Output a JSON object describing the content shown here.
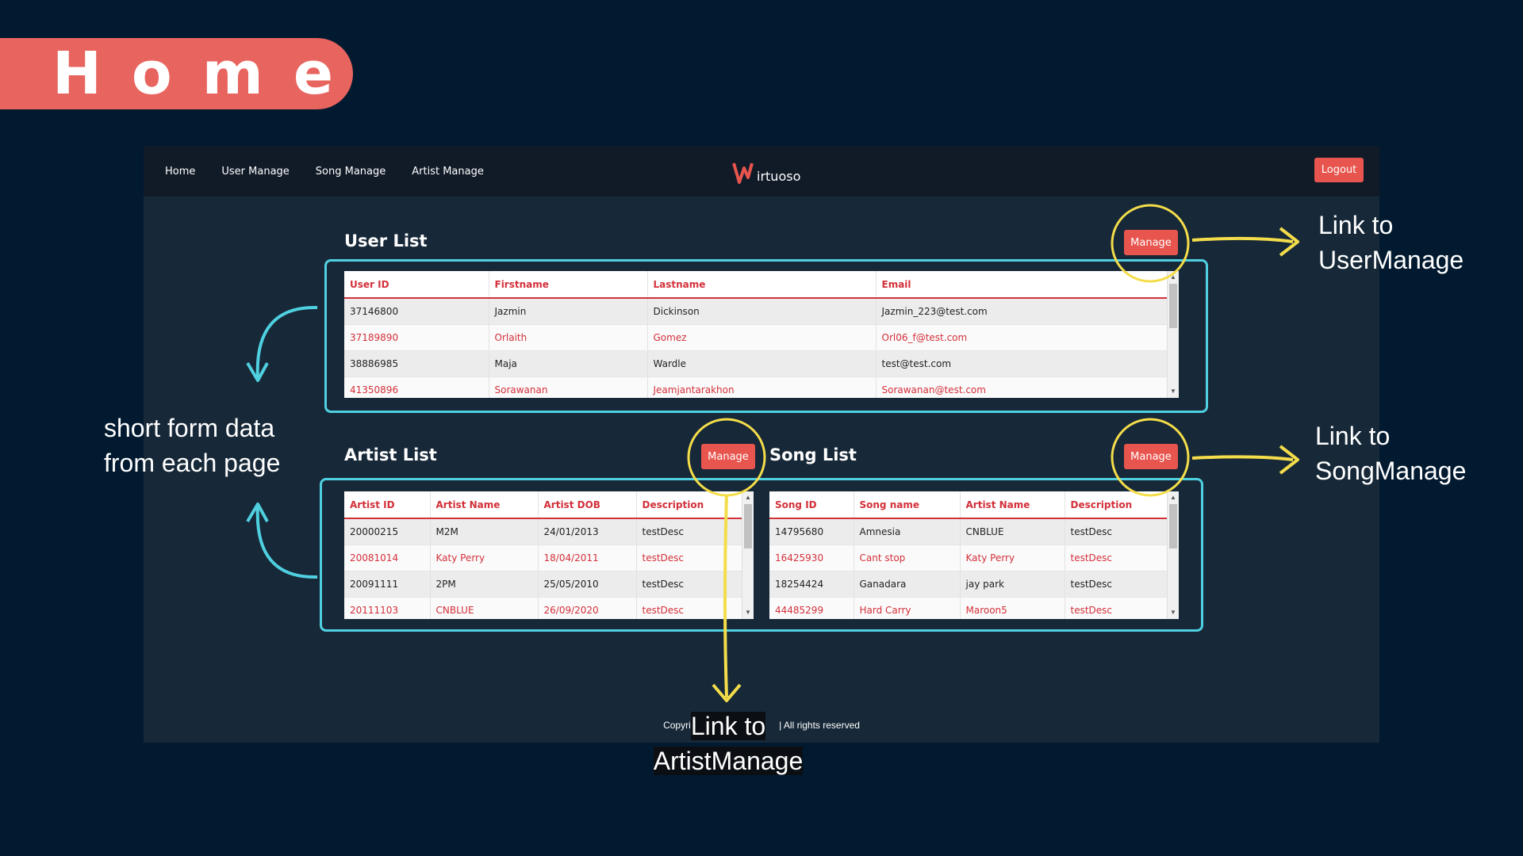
{
  "slide": {
    "title": "Home"
  },
  "navbar": {
    "links": [
      "Home",
      "User Manage",
      "Song Manage",
      "Artist Manage"
    ],
    "logo_text": "irtuoso",
    "logout_label": "Logout"
  },
  "user_list": {
    "title": "User List",
    "manage_label": "Manage",
    "headers": [
      "User ID",
      "Firstname",
      "Lastname",
      "Email"
    ],
    "rows": [
      [
        "37146800",
        "Jazmin",
        "Dickinson",
        "Jazmin_223@test.com"
      ],
      [
        "37189890",
        "Orlaith",
        "Gomez",
        "Orl06_f@test.com"
      ],
      [
        "38886985",
        "Maja",
        "Wardle",
        "test@test.com"
      ],
      [
        "41350896",
        "Sorawanan",
        "Jeamjantarakhon",
        "Sorawanan@test.com"
      ]
    ]
  },
  "artist_list": {
    "title": "Artist List",
    "manage_label": "Manage",
    "headers": [
      "Artist ID",
      "Artist Name",
      "Artist DOB",
      "Description"
    ],
    "rows": [
      [
        "20000215",
        "M2M",
        "24/01/2013",
        "testDesc"
      ],
      [
        "20081014",
        "Katy Perry",
        "18/04/2011",
        "testDesc"
      ],
      [
        "20091111",
        "2PM",
        "25/05/2010",
        "testDesc"
      ],
      [
        "20111103",
        "CNBLUE",
        "26/09/2020",
        "testDesc"
      ]
    ]
  },
  "song_list": {
    "title": "Song List",
    "manage_label": "Manage",
    "headers": [
      "Song ID",
      "Song name",
      "Artist Name",
      "Description"
    ],
    "rows": [
      [
        "14795680",
        "Amnesia",
        "CNBLUE",
        "testDesc"
      ],
      [
        "16425930",
        "Cant stop",
        "Katy Perry",
        "testDesc"
      ],
      [
        "18254424",
        "Ganadara",
        "jay park",
        "testDesc"
      ],
      [
        "44485299",
        "Hard Carry",
        "Maroon5",
        "testDesc"
      ]
    ]
  },
  "footer": {
    "left": "Copyright",
    "right": "| All rights reserved"
  },
  "annotations": {
    "user_manage": [
      "Link to",
      "UserManage"
    ],
    "song_manage": [
      "Link to",
      "SongManage"
    ],
    "artist_manage": [
      "Link to",
      "ArtistManage"
    ],
    "short_form": [
      "short form data",
      "from each page"
    ]
  },
  "colors": {
    "background": "#021a30",
    "accent_red": "#e8554e",
    "highlight_cyan": "#4fd0e0",
    "highlight_yellow": "#f4dd4a"
  }
}
